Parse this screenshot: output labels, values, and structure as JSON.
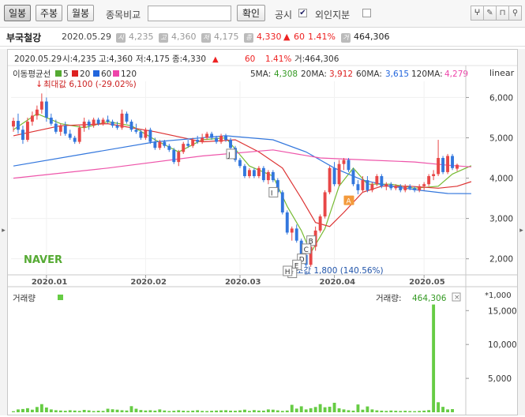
{
  "toolbar": {
    "period_tabs": [
      {
        "label": "일봉",
        "active": true
      },
      {
        "label": "주봉",
        "active": false
      },
      {
        "label": "월봉",
        "active": false
      }
    ],
    "compare_label": "종목비교",
    "confirm_label": "확인",
    "disclosure_label": "공시",
    "disclosure_checked": true,
    "foreign_label": "외인지분",
    "foreign_checked": false,
    "tool_icons": [
      "pen-tool-icon",
      "eraser-icon",
      "magnet-icon",
      "magnifier-icon"
    ]
  },
  "info": {
    "stock_name": "부국철강",
    "date": "2020.05.29",
    "open": "4,235",
    "high": "4,360",
    "low": "4,175",
    "close": "4,330",
    "change": "60",
    "change_pct": "1.41%",
    "volume": "464,306",
    "open_icon": "시",
    "high_icon": "고",
    "low_icon": "저",
    "close_icon": "종",
    "volume_icon": "거"
  },
  "chart_header": {
    "date": "2020.05.29",
    "open_label": "시:",
    "open": "4,235",
    "high_label": "고:",
    "high": "4,360",
    "low_label": "저:",
    "low": "4,175",
    "close_label": "종:",
    "close": "4,330",
    "arrow": "▲",
    "change": "60",
    "change_pct": "1.41%",
    "vol_label": "거:",
    "volume": "464,306"
  },
  "ma_legend": {
    "title": "이동평균선",
    "items": [
      {
        "label": "5",
        "color": "#55aa33"
      },
      {
        "label": "20",
        "color": "#dd2222"
      },
      {
        "label": "60",
        "color": "#2266dd"
      },
      {
        "label": "120",
        "color": "#ee44aa"
      }
    ],
    "values": [
      {
        "label": "5MA:",
        "value": "4,308",
        "color": "#339922"
      },
      {
        "label": "20MA:",
        "value": "3,912",
        "color": "#dd2222"
      },
      {
        "label": "60MA:",
        "value": "3,615",
        "color": "#2266dd"
      },
      {
        "label": "120MA:",
        "value": "4,279",
        "color": "#ee44aa"
      }
    ],
    "scale_label": "linear"
  },
  "annotations": {
    "max_label": "최대값 6,100 (-29.02%)",
    "min_label": "최소값 1,800 (140.56%)",
    "watermark": "NAVER",
    "event_markers": [
      "J",
      "I",
      "B",
      "C",
      "D",
      "E",
      "F",
      "H"
    ],
    "disclosure_marker": "A"
  },
  "volume_panel": {
    "title": "거래량",
    "value_label": "거래량:",
    "value": "464,306",
    "unit": "*1,000",
    "close_icon": "×",
    "y_ticks": [
      "15,000",
      "10,000",
      "5,000"
    ]
  },
  "chart_data": {
    "type": "candlestick",
    "x_ticks": [
      "2020.01",
      "2020.02",
      "2020.03",
      "2020.04",
      "2020.05"
    ],
    "y_ticks": [
      "6,000",
      "5,000",
      "4,000",
      "3,000",
      "2,000"
    ],
    "ylim": [
      1700,
      6400
    ],
    "y_scale": "linear",
    "colors": {
      "up": "#e84747",
      "down": "#3377dd"
    },
    "candles": [
      [
        5280,
        5500,
        5150,
        5420
      ],
      [
        5420,
        5600,
        5100,
        5200
      ],
      [
        5200,
        5300,
        4850,
        4950
      ],
      [
        4950,
        5500,
        4900,
        5400
      ],
      [
        5400,
        5650,
        5300,
        5550
      ],
      [
        5550,
        5800,
        5450,
        5700
      ],
      [
        5700,
        6100,
        5600,
        5900
      ],
      [
        5900,
        6000,
        5400,
        5500
      ],
      [
        5500,
        5600,
        5300,
        5350
      ],
      [
        5350,
        5450,
        5100,
        5150
      ],
      [
        5150,
        5350,
        5050,
        5300
      ],
      [
        5300,
        5400,
        5050,
        5100
      ],
      [
        5100,
        5200,
        4950,
        5000
      ],
      [
        5000,
        5050,
        4850,
        4900
      ],
      [
        4900,
        5300,
        4850,
        5250
      ],
      [
        5250,
        5500,
        5150,
        5400
      ],
      [
        5400,
        5450,
        5200,
        5300
      ],
      [
        5300,
        5500,
        5250,
        5450
      ],
      [
        5450,
        5500,
        5300,
        5350
      ],
      [
        5350,
        5500,
        5300,
        5450
      ],
      [
        5450,
        5550,
        5350,
        5400
      ],
      [
        5400,
        5450,
        5250,
        5300
      ],
      [
        5300,
        5400,
        5200,
        5250
      ],
      [
        5250,
        5700,
        5200,
        5600
      ],
      [
        5600,
        5650,
        5350,
        5400
      ],
      [
        5400,
        5450,
        5150,
        5200
      ],
      [
        5200,
        5350,
        5100,
        5150
      ],
      [
        5150,
        5200,
        4950,
        5000
      ],
      [
        5000,
        5250,
        4950,
        5200
      ],
      [
        5200,
        5250,
        4850,
        4900
      ],
      [
        4900,
        5000,
        4700,
        4750
      ],
      [
        4750,
        4950,
        4700,
        4900
      ],
      [
        4900,
        4950,
        4750,
        4800
      ],
      [
        4800,
        4850,
        4650,
        4700
      ],
      [
        4700,
        4750,
        4350,
        4400
      ],
      [
        4400,
        4700,
        4300,
        4650
      ],
      [
        4650,
        4900,
        4600,
        4850
      ],
      [
        4850,
        4950,
        4750,
        4800
      ],
      [
        4800,
        5000,
        4750,
        4950
      ],
      [
        4950,
        5050,
        4850,
        4900
      ],
      [
        4900,
        5100,
        4850,
        5000
      ],
      [
        5000,
        5150,
        4950,
        5100
      ],
      [
        5100,
        5150,
        4950,
        5000
      ],
      [
        5000,
        5050,
        4850,
        4900
      ],
      [
        4900,
        5100,
        4850,
        5050
      ],
      [
        5050,
        5100,
        4900,
        4950
      ],
      [
        4950,
        5000,
        4700,
        4750
      ],
      [
        4750,
        4800,
        4400,
        4450
      ],
      [
        4450,
        4500,
        4250,
        4300
      ],
      [
        4300,
        4350,
        4000,
        4050
      ],
      [
        4050,
        4250,
        4000,
        4200
      ],
      [
        4200,
        4250,
        4000,
        4050
      ],
      [
        4050,
        4300,
        4000,
        4250
      ],
      [
        4250,
        4300,
        3900,
        3950
      ],
      [
        3950,
        4200,
        3850,
        4150
      ],
      [
        4150,
        4200,
        3900,
        3950
      ],
      [
        3950,
        4000,
        3600,
        3650
      ],
      [
        3650,
        3700,
        3100,
        3150
      ],
      [
        3150,
        3200,
        2600,
        2650
      ],
      [
        2650,
        2800,
        2450,
        2750
      ],
      [
        2750,
        2850,
        2400,
        2450
      ],
      [
        2450,
        2500,
        2050,
        2100
      ],
      [
        2100,
        2200,
        1800,
        1850
      ],
      [
        1850,
        2350,
        1800,
        2300
      ],
      [
        2300,
        2800,
        2200,
        2700
      ],
      [
        2700,
        3100,
        2650,
        3050
      ],
      [
        3050,
        3700,
        3000,
        3650
      ],
      [
        3650,
        4300,
        3600,
        4250
      ],
      [
        4250,
        4400,
        3800,
        3850
      ],
      [
        3850,
        4450,
        3800,
        4350
      ],
      [
        4350,
        4500,
        4200,
        4450
      ],
      [
        4450,
        4500,
        4150,
        4200
      ],
      [
        4200,
        4250,
        3800,
        3850
      ],
      [
        3850,
        3950,
        3600,
        3700
      ],
      [
        3700,
        4050,
        3650,
        3950
      ],
      [
        3950,
        4050,
        3650,
        3700
      ],
      [
        3700,
        3900,
        3650,
        3850
      ],
      [
        3850,
        4100,
        3800,
        4050
      ],
      [
        4050,
        4100,
        3750,
        3800
      ],
      [
        3800,
        3900,
        3700,
        3850
      ],
      [
        3850,
        3900,
        3700,
        3750
      ],
      [
        3750,
        3850,
        3700,
        3800
      ],
      [
        3800,
        3850,
        3650,
        3700
      ],
      [
        3700,
        3850,
        3650,
        3800
      ],
      [
        3800,
        3850,
        3700,
        3750
      ],
      [
        3750,
        3800,
        3650,
        3700
      ],
      [
        3700,
        3850,
        3650,
        3800
      ],
      [
        3800,
        3900,
        3700,
        3850
      ],
      [
        3850,
        4100,
        3800,
        4050
      ],
      [
        4050,
        4200,
        3950,
        4100
      ],
      [
        4100,
        4950,
        4050,
        4500
      ],
      [
        4500,
        4550,
        4100,
        4150
      ],
      [
        4150,
        4600,
        4100,
        4550
      ],
      [
        4550,
        4600,
        4200,
        4250
      ],
      [
        4235,
        4360,
        4175,
        4330
      ]
    ],
    "ma_series": [
      {
        "name": "5",
        "color": "#77bb33",
        "values": [
          [
            0,
            5200
          ],
          [
            5,
            5600
          ],
          [
            10,
            5350
          ],
          [
            15,
            5250
          ],
          [
            20,
            5400
          ],
          [
            25,
            5300
          ],
          [
            30,
            4950
          ],
          [
            35,
            4650
          ],
          [
            40,
            4950
          ],
          [
            45,
            5000
          ],
          [
            50,
            4300
          ],
          [
            55,
            4050
          ],
          [
            58,
            3300
          ],
          [
            61,
            2700
          ],
          [
            63,
            2150
          ],
          [
            66,
            2750
          ],
          [
            69,
            3800
          ],
          [
            72,
            4250
          ],
          [
            75,
            3850
          ],
          [
            80,
            3850
          ],
          [
            85,
            3750
          ],
          [
            90,
            3800
          ],
          [
            93,
            4100
          ],
          [
            97,
            4308
          ]
        ]
      },
      {
        "name": "20",
        "color": "#dd3333",
        "values": [
          [
            0,
            5050
          ],
          [
            10,
            5300
          ],
          [
            20,
            5350
          ],
          [
            30,
            5150
          ],
          [
            40,
            4900
          ],
          [
            47,
            4950
          ],
          [
            52,
            4650
          ],
          [
            57,
            4250
          ],
          [
            61,
            3500
          ],
          [
            64,
            2900
          ],
          [
            67,
            2800
          ],
          [
            70,
            3150
          ],
          [
            74,
            3650
          ],
          [
            78,
            3800
          ],
          [
            84,
            3800
          ],
          [
            90,
            3750
          ],
          [
            94,
            3800
          ],
          [
            97,
            3912
          ]
        ]
      },
      {
        "name": "60",
        "color": "#3377dd",
        "values": [
          [
            0,
            4300
          ],
          [
            15,
            4600
          ],
          [
            30,
            4900
          ],
          [
            45,
            5050
          ],
          [
            55,
            4950
          ],
          [
            62,
            4650
          ],
          [
            68,
            4250
          ],
          [
            74,
            3950
          ],
          [
            80,
            3800
          ],
          [
            86,
            3700
          ],
          [
            92,
            3620
          ],
          [
            97,
            3615
          ]
        ]
      },
      {
        "name": "120",
        "color": "#ee55aa",
        "values": [
          [
            0,
            4000
          ],
          [
            20,
            4250
          ],
          [
            40,
            4550
          ],
          [
            55,
            4700
          ],
          [
            65,
            4500
          ],
          [
            75,
            4450
          ],
          [
            85,
            4400
          ],
          [
            92,
            4320
          ],
          [
            97,
            4279
          ]
        ]
      }
    ],
    "volume": [
      150,
      420,
      480,
      600,
      380,
      780,
      1200,
      700,
      420,
      300,
      260,
      220,
      300,
      250,
      200,
      350,
      280,
      180,
      230,
      200,
      520,
      440,
      380,
      300,
      260,
      900,
      520,
      330,
      260,
      300,
      240,
      420,
      260,
      180,
      220,
      300,
      230,
      200,
      240,
      300,
      200,
      180,
      220,
      250,
      280,
      300,
      240,
      220,
      280,
      380,
      200,
      320,
      250,
      240,
      420,
      380,
      280,
      200,
      260,
      1100,
      540,
      880,
      420,
      600,
      780,
      1200,
      740,
      820,
      1400,
      580,
      420,
      300,
      240,
      1150,
      380,
      860,
      420,
      280,
      240,
      200,
      260,
      220,
      190,
      220,
      180,
      160,
      200,
      240,
      320,
      15900,
      1480,
      800,
      420,
      464
    ]
  }
}
